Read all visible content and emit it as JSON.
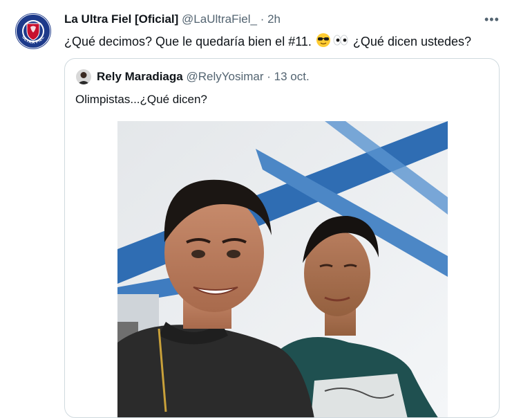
{
  "tweet": {
    "author_name": "La Ultra Fiel [Oficial]",
    "author_handle": "@LaUltraFiel_",
    "separator": "·",
    "time": "2h",
    "more_label": "•••",
    "text_part1": "¿Qué decimos? Que le quedaría bien el #11.",
    "text_part2": "¿Qué dicen ustedes?",
    "logo_text": "ULTRA FIEL",
    "emojis": [
      "sunglasses-face-icon",
      "eyes-icon"
    ]
  },
  "quoted": {
    "author_name": "Rely Maradiaga",
    "author_handle": "@RelyYosimar",
    "separator": "·",
    "date": "13 oct.",
    "text": "Olimpistas...¿Qué dicen?"
  },
  "colors": {
    "text": "#0f1419",
    "muted": "#536471",
    "border": "#cfd9de",
    "logo_blue": "#1d3a8a",
    "logo_red": "#c8102e"
  }
}
